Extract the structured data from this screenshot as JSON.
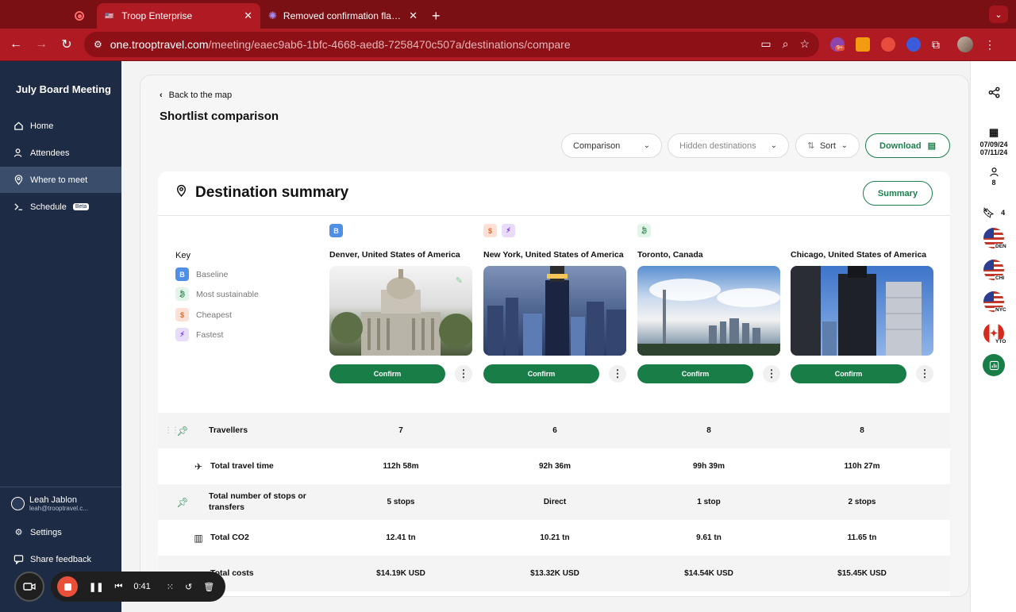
{
  "browser": {
    "tabs": [
      {
        "title": "Troop Enterprise",
        "active": true
      },
      {
        "title": "Removed confirmation flag/cl",
        "active": false
      }
    ],
    "url_host": "one.trooptravel.com",
    "url_path": "/meeting/eaec9ab6-1bfc-4668-aed8-7258470c507a/destinations/compare",
    "ext_badge": "9+"
  },
  "sidebar": {
    "title": "July Board Meeting",
    "items": [
      {
        "label": "Home",
        "icon": "home-icon"
      },
      {
        "label": "Attendees",
        "icon": "people-icon"
      },
      {
        "label": "Where to meet",
        "icon": "location-pin-icon",
        "active": true
      },
      {
        "label": "Schedule",
        "icon": "schedule-icon",
        "badge": "Beta"
      }
    ],
    "user": {
      "name": "Leah Jablon",
      "email": "leah@trooptravel.c..."
    },
    "settings": "Settings",
    "feedback": "Share feedback"
  },
  "main": {
    "back_label": "Back to the map",
    "title": "Shortlist comparison",
    "controls": {
      "comparison": "Comparison",
      "hidden": "Hidden destinations",
      "sort": "Sort",
      "download": "Download"
    },
    "summary": {
      "heading": "Destination summary",
      "button": "Summary",
      "key_title": "Key",
      "key": [
        {
          "badge": "B",
          "label": "Baseline"
        },
        {
          "badge": "",
          "label": "Most sustainable"
        },
        {
          "badge": "$",
          "label": "Cheapest"
        },
        {
          "badge": "",
          "label": "Fastest"
        }
      ],
      "confirm_label": "Confirm",
      "destinations": [
        {
          "name": "Denver, United States of America"
        },
        {
          "name": "New York, United States of America"
        },
        {
          "name": "Toronto, Canada"
        },
        {
          "name": "Chicago, United States of America"
        }
      ],
      "rows": [
        {
          "label": "Travellers",
          "values": [
            "7",
            "6",
            "8",
            "8"
          ]
        },
        {
          "label": "Total travel time",
          "values": [
            "112h 58m",
            "92h 36m",
            "99h 39m",
            "110h 27m"
          ]
        },
        {
          "label": "Total number of stops or transfers",
          "values": [
            "5 stops",
            "Direct",
            "1 stop",
            "2 stops"
          ]
        },
        {
          "label": "Total CO2",
          "values": [
            "12.41 tn",
            "10.21 tn",
            "9.61 tn",
            "11.65 tn"
          ]
        },
        {
          "label": "Total costs",
          "values": [
            "$14.19K USD",
            "$13.32K USD",
            "$14.54K USD",
            "$15.45K USD"
          ]
        }
      ]
    }
  },
  "rightbar": {
    "date_start": "07/09/24",
    "date_end": "07/11/24",
    "attendees": "8",
    "bookmarks": "4",
    "flags": [
      {
        "code": "DEN"
      },
      {
        "code": "CHI"
      },
      {
        "code": "NYC"
      },
      {
        "code": "YTO"
      }
    ]
  },
  "recorder": {
    "time": "0:41"
  }
}
